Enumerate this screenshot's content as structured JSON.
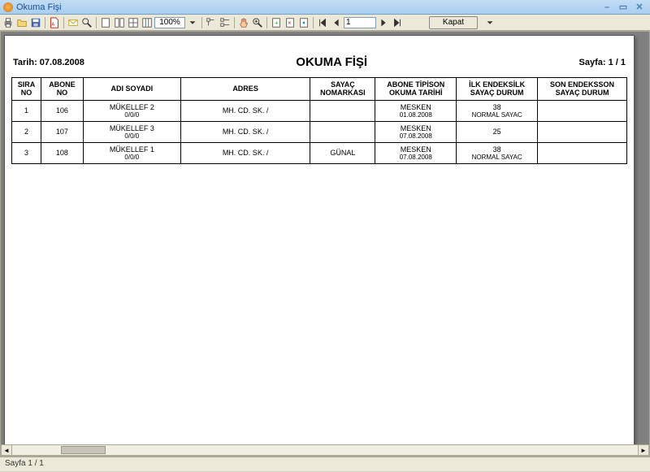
{
  "window": {
    "title": "Okuma Fişi"
  },
  "toolbar": {
    "zoom": "100%",
    "page_input": "1",
    "close_label": "Kapat"
  },
  "report": {
    "date_label": "Tarih: 07.08.2008",
    "title": "OKUMA FİŞİ",
    "page_label": "Sayfa: 1 / 1",
    "headers": {
      "sira": "SIRA NO",
      "abone": "ABONE NO",
      "ad": "ADI SOYADI",
      "adres": "ADRES",
      "sayac1": "SAYAÇ NO",
      "sayac2": "MARKASI",
      "tip1": "ABONE TİPİ",
      "tip2": "SON OKUMA TARİHİ",
      "ilk1": "İLK ENDEKS",
      "ilk2": "İLK SAYAÇ DURUM",
      "son1": "SON ENDEKS",
      "son2": "SON SAYAÇ DURUM"
    },
    "rows": [
      {
        "sira": "1",
        "abone": "106",
        "ad1": "MÜKELLEF 2",
        "ad2": "0/0/0",
        "adres": "MH.  CD.  SK.  /",
        "sayac": "",
        "tip1": "MESKEN",
        "tip2": "01.08.2008",
        "ilk1": "38",
        "ilk2": "NORMAL SAYAC",
        "son": ""
      },
      {
        "sira": "2",
        "abone": "107",
        "ad1": "MÜKELLEF 3",
        "ad2": "0/0/0",
        "adres": "MH.  CD.  SK.  /",
        "sayac": "",
        "tip1": "MESKEN",
        "tip2": "07.08.2008",
        "ilk1": "25",
        "ilk2": "",
        "son": ""
      },
      {
        "sira": "3",
        "abone": "108",
        "ad1": "MÜKELLEF 1",
        "ad2": "0/0/0",
        "adres": "MH.  CD.  SK.  /",
        "sayac": "GÜNAL",
        "tip1": "MESKEN",
        "tip2": "07.08.2008",
        "ilk1": "38",
        "ilk2": "NORMAL SAYAC",
        "son": ""
      }
    ]
  },
  "status": {
    "text": "Sayfa 1 / 1"
  }
}
